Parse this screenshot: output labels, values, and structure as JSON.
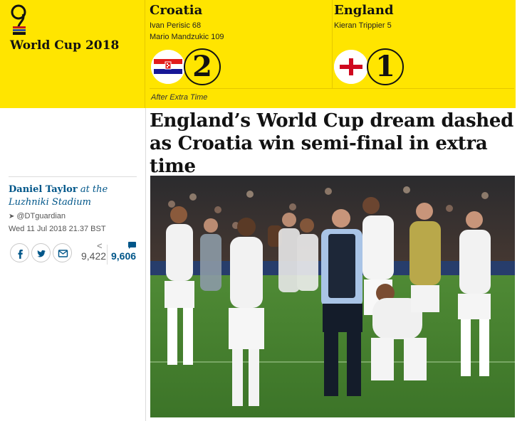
{
  "competition": {
    "name": "World Cup 2018",
    "icon": "world-cup-trophy-icon"
  },
  "home": {
    "team": "Croatia",
    "scorers": [
      "Ivan Perisic 68",
      "Mario Mandzukic 109"
    ],
    "score": "2",
    "flag": "croatia-flag-icon"
  },
  "away": {
    "team": "England",
    "scorers": [
      "Kieran Trippier 5"
    ],
    "score": "1",
    "flag": "england-flag-icon"
  },
  "status": "After Extra Time",
  "headline": "England’s World Cup dream dashed as Croatia win semi-final in extra time",
  "byline": {
    "author": "Daniel Taylor",
    "location": "at the Luzhniki Stadium"
  },
  "twitter_handle": "@DTguardian",
  "dateline": "Wed 11 Jul 2018 21.37 BST",
  "share": {
    "count": "9,422",
    "buttons": [
      "facebook-icon",
      "twitter-icon",
      "email-icon"
    ]
  },
  "comments": {
    "count": "9,606"
  },
  "colors": {
    "band": "#ffe500",
    "link_blue": "#005689",
    "england_red": "#cf081f",
    "croatia_red": "#e21b1b",
    "croatia_blue": "#171796"
  }
}
